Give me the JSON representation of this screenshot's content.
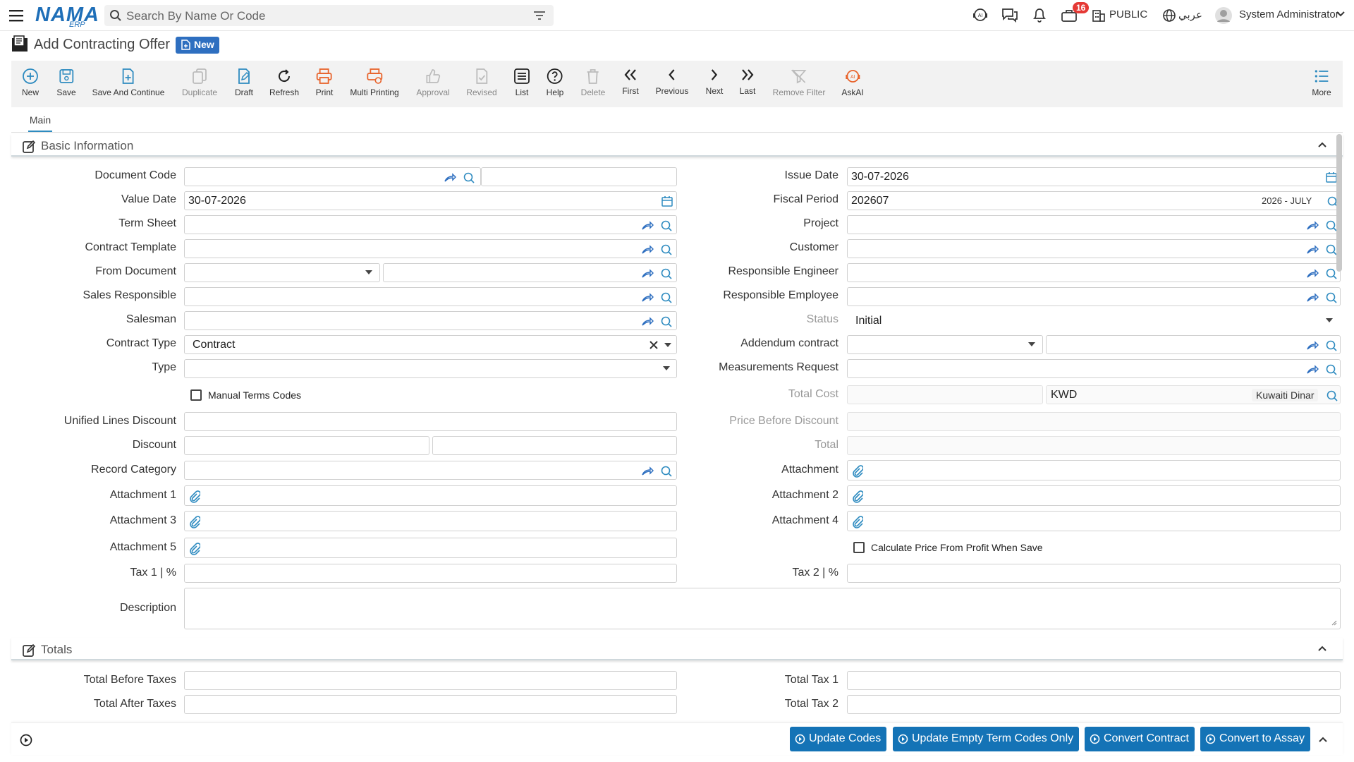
{
  "header": {
    "logo_text": "NAMA",
    "logo_sub": "ERP",
    "search_placeholder": "Search By Name Or Code",
    "notification_count": "16",
    "public_label": "PUBLIC",
    "language_label": "عربي",
    "user_name": "System Administrator"
  },
  "page": {
    "title": "Add Contracting Offer",
    "mode_badge": "New"
  },
  "toolbar": {
    "new": "New",
    "save": "Save",
    "save_continue": "Save And Continue",
    "duplicate": "Duplicate",
    "draft": "Draft",
    "refresh": "Refresh",
    "print": "Print",
    "multi_printing": "Multi Printing",
    "approval": "Approval",
    "revised": "Revised",
    "list": "List",
    "help": "Help",
    "delete": "Delete",
    "first": "First",
    "previous": "Previous",
    "next": "Next",
    "last": "Last",
    "remove_filter": "Remove Filter",
    "askai": "AskAI",
    "more": "More"
  },
  "tabs": {
    "main": "Main"
  },
  "basic": {
    "title": "Basic Information",
    "document_code": "Document Code",
    "value_date": "Value Date",
    "value_date_val": "30-07-2026",
    "term_sheet": "Term Sheet",
    "contract_template": "Contract Template",
    "from_document": "From Document",
    "sales_responsible": "Sales Responsible",
    "salesman": "Salesman",
    "contract_type": "Contract Type",
    "contract_type_val": "Contract",
    "type": "Type",
    "manual_terms_codes": "Manual Terms Codes",
    "unified_lines_discount": "Unified Lines Discount",
    "discount": "Discount",
    "record_category": "Record Category",
    "attachment_1": "Attachment 1",
    "attachment_3": "Attachment 3",
    "attachment_5": "Attachment 5",
    "tax1": "Tax 1 | %",
    "description": "Description",
    "issue_date": "Issue Date",
    "issue_date_val": "30-07-2026",
    "fiscal_period": "Fiscal Period",
    "fiscal_period_val": "202607",
    "fiscal_period_hint": "2026 - JULY",
    "project": "Project",
    "customer": "Customer",
    "responsible_engineer": "Responsible Engineer",
    "responsible_employee": "Responsible Employee",
    "status": "Status",
    "status_val": "Initial",
    "addendum_contract": "Addendum contract",
    "measurements_request": "Measurements Request",
    "total_cost": "Total Cost",
    "currency_code": "KWD",
    "currency_name": "Kuwaiti Dinar",
    "price_before_discount": "Price Before Discount",
    "total": "Total",
    "attachment": "Attachment",
    "attachment_2": "Attachment 2",
    "attachment_4": "Attachment 4",
    "calc_price_profit": "Calculate Price From Profit When Save",
    "tax2": "Tax 2 | %"
  },
  "totals": {
    "title": "Totals",
    "total_before_taxes": "Total Before Taxes",
    "total_after_taxes": "Total After Taxes",
    "total_tax1": "Total Tax 1",
    "total_tax2": "Total Tax 2"
  },
  "footer": {
    "update_codes": "Update Codes",
    "update_empty": "Update Empty Term Codes Only",
    "convert_contract": "Convert Contract",
    "convert_assay": "Convert to Assay"
  },
  "colors": {
    "primary": "#1473b6",
    "accent_blue": "#2e8bc0",
    "badge_red": "#e53935",
    "print_orange": "#e8632b"
  }
}
